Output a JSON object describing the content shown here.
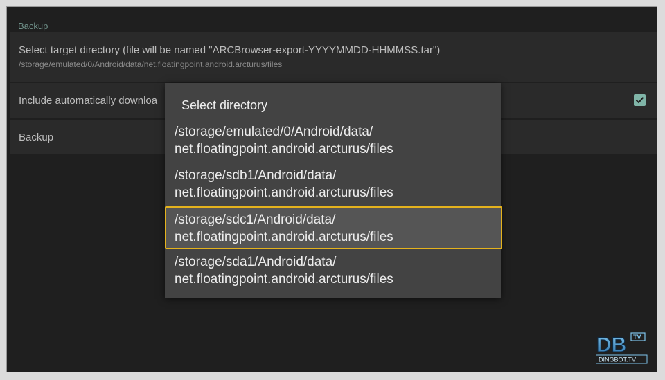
{
  "section": {
    "header": "Backup"
  },
  "prefs": {
    "target": {
      "title": "Select target directory (file will be named \"ARCBrowser-export-YYYYMMDD-HHMMSS.tar\")",
      "summary": "/storage/emulated/0/Android/data/net.floatingpoint.android.arcturus/files"
    },
    "include": {
      "title": "Include automatically downloa",
      "checked": true
    },
    "backup": {
      "title": "Backup"
    }
  },
  "dialog": {
    "title": "Select directory",
    "items": [
      {
        "line1": "/storage/emulated/0/Android/data/",
        "line2": "net.floatingpoint.android.arcturus/files"
      },
      {
        "line1": "/storage/sdb1/Android/data/",
        "line2": "net.floatingpoint.android.arcturus/files"
      },
      {
        "line1": "/storage/sdc1/Android/data/",
        "line2": "net.floatingpoint.android.arcturus/files",
        "focused": true
      },
      {
        "line1": "/storage/sda1/Android/data/",
        "line2": "net.floatingpoint.android.arcturus/files"
      }
    ]
  },
  "watermark": {
    "logo": "DB",
    "badge": "TV",
    "site": "DINGBOT.TV"
  },
  "colors": {
    "focus": "#e4b21d",
    "accent": "#80b5a8",
    "background": "#1f1f1f",
    "dialog": "#434343"
  }
}
